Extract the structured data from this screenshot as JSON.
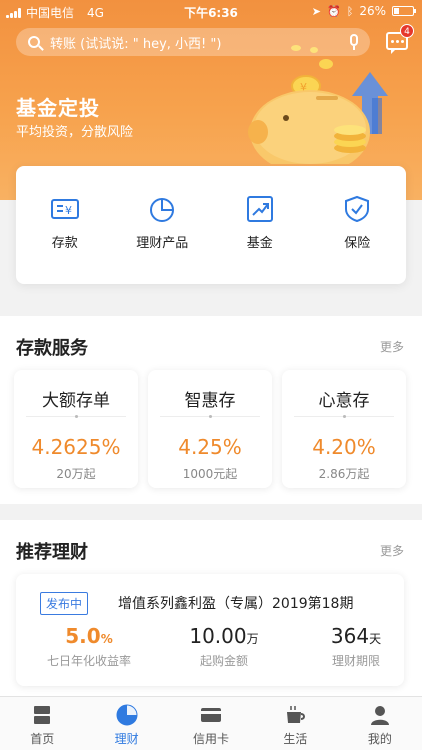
{
  "status": {
    "carrier": "中国电信",
    "network": "4G",
    "time": "下午6:36",
    "battery": "26%"
  },
  "search": {
    "placeholder": "转账 (试试说: \" hey, 小西! \")"
  },
  "messages": {
    "badge": "4"
  },
  "hero": {
    "title": "基金定投",
    "subtitle": "平均投资，分散风险"
  },
  "quick_actions": [
    {
      "label": "存款",
      "icon": "deposit-icon"
    },
    {
      "label": "理财产品",
      "icon": "pie-chart-icon"
    },
    {
      "label": "基金",
      "icon": "trend-up-icon"
    },
    {
      "label": "保险",
      "icon": "shield-icon"
    }
  ],
  "deposit": {
    "title": "存款服务",
    "more": "更多",
    "cards": [
      {
        "name": "大额存单",
        "rate": "4.2625%",
        "min": "20万起"
      },
      {
        "name": "智惠存",
        "rate": "4.25%",
        "min": "1000元起"
      },
      {
        "name": "心意存",
        "rate": "4.20%",
        "min": "2.86万起"
      }
    ]
  },
  "recommend": {
    "title": "推荐理财",
    "more": "更多",
    "product": {
      "tag": "发布中",
      "name": "增值系列鑫利盈（专属）2019第18期",
      "yield_value": "5.0",
      "yield_unit": "%",
      "yield_label": "七日年化收益率",
      "min_value": "10.00",
      "min_unit": "万",
      "min_label": "起购金额",
      "term_value": "364",
      "term_unit": "天",
      "term_label": "理财期限"
    }
  },
  "tabs": [
    {
      "label": "首页",
      "icon": "home-icon",
      "active": false
    },
    {
      "label": "理财",
      "icon": "wealth-icon",
      "active": true
    },
    {
      "label": "信用卡",
      "icon": "credit-card-icon",
      "active": false
    },
    {
      "label": "生活",
      "icon": "life-icon",
      "active": false
    },
    {
      "label": "我的",
      "icon": "profile-icon",
      "active": false
    }
  ],
  "colors": {
    "accent_orange": "#f2913f",
    "rate_orange": "#ef8a2c",
    "active_blue": "#2f7ae0"
  }
}
